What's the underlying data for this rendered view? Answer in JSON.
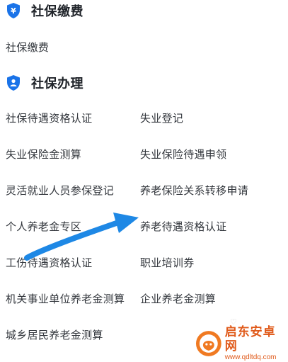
{
  "section_payment": {
    "title": "社保缴费",
    "icon": "shield-yen-icon",
    "items": [
      "社保缴费"
    ]
  },
  "section_handling": {
    "title": "社保办理",
    "icon": "shield-person-icon",
    "items": [
      "社保待遇资格认证",
      "失业登记",
      "失业保险金测算",
      "失业保险待遇申领",
      "灵活就业人员参保登记",
      "养老保险关系转移申请",
      "个人养老金专区",
      "养老待遇资格认证",
      "工伤待遇资格认证",
      "职业培训券",
      "机关事业单位养老金测算",
      "企业养老金测算",
      "城乡居民养老金测算"
    ]
  },
  "watermark": {
    "name": "启东安卓网",
    "url": "www.qdltdq.com"
  },
  "colors": {
    "accent": "#1a73e8",
    "arrow": "#1e88e5",
    "watermark": "#e05a1a"
  }
}
